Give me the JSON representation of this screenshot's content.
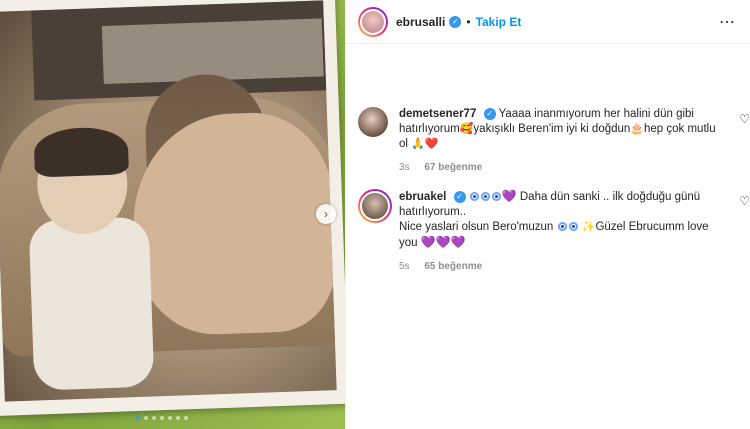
{
  "header": {
    "username": "ebrusalli",
    "separator": "•",
    "follow_label": "Takip Et",
    "more_glyph": "⋯"
  },
  "media": {
    "next_glyph": "›",
    "dots_count": 7,
    "active_dot": 0
  },
  "comments": [
    {
      "username": "demetsener77",
      "text_1": "Yaaaa inanmıyorum her halini dün gibi hatırlıyorum",
      "emoji_1": "🥰",
      "text_2": "yakışıklı Beren'im iyi ki doğdun",
      "emoji_2": "🎂",
      "text_3": "hep çok mutlu ol",
      "emoji_3": "🙏",
      "emoji_4": "❤️",
      "time": "3s",
      "likes": "67 beğenme"
    },
    {
      "username": "ebruakel",
      "emoji_hearts_1": "💜",
      "text_1": "Daha dün sanki .. ilk doğduğu günü hatırlıyorum..",
      "text_2": "Nice yaslari olsun Bero'muzun",
      "emoji_star": "✨",
      "text_3": "Güzel Ebrucumm love you",
      "emoji_hearts_2": "💜💜💜",
      "time": "5s",
      "likes": "65 beğenme"
    }
  ],
  "icons": {
    "heart": "♡",
    "verified": "✓"
  },
  "colors": {
    "link_blue": "#0095f6",
    "verified_blue": "#3897f0",
    "meta_gray": "#8e8e8e"
  }
}
